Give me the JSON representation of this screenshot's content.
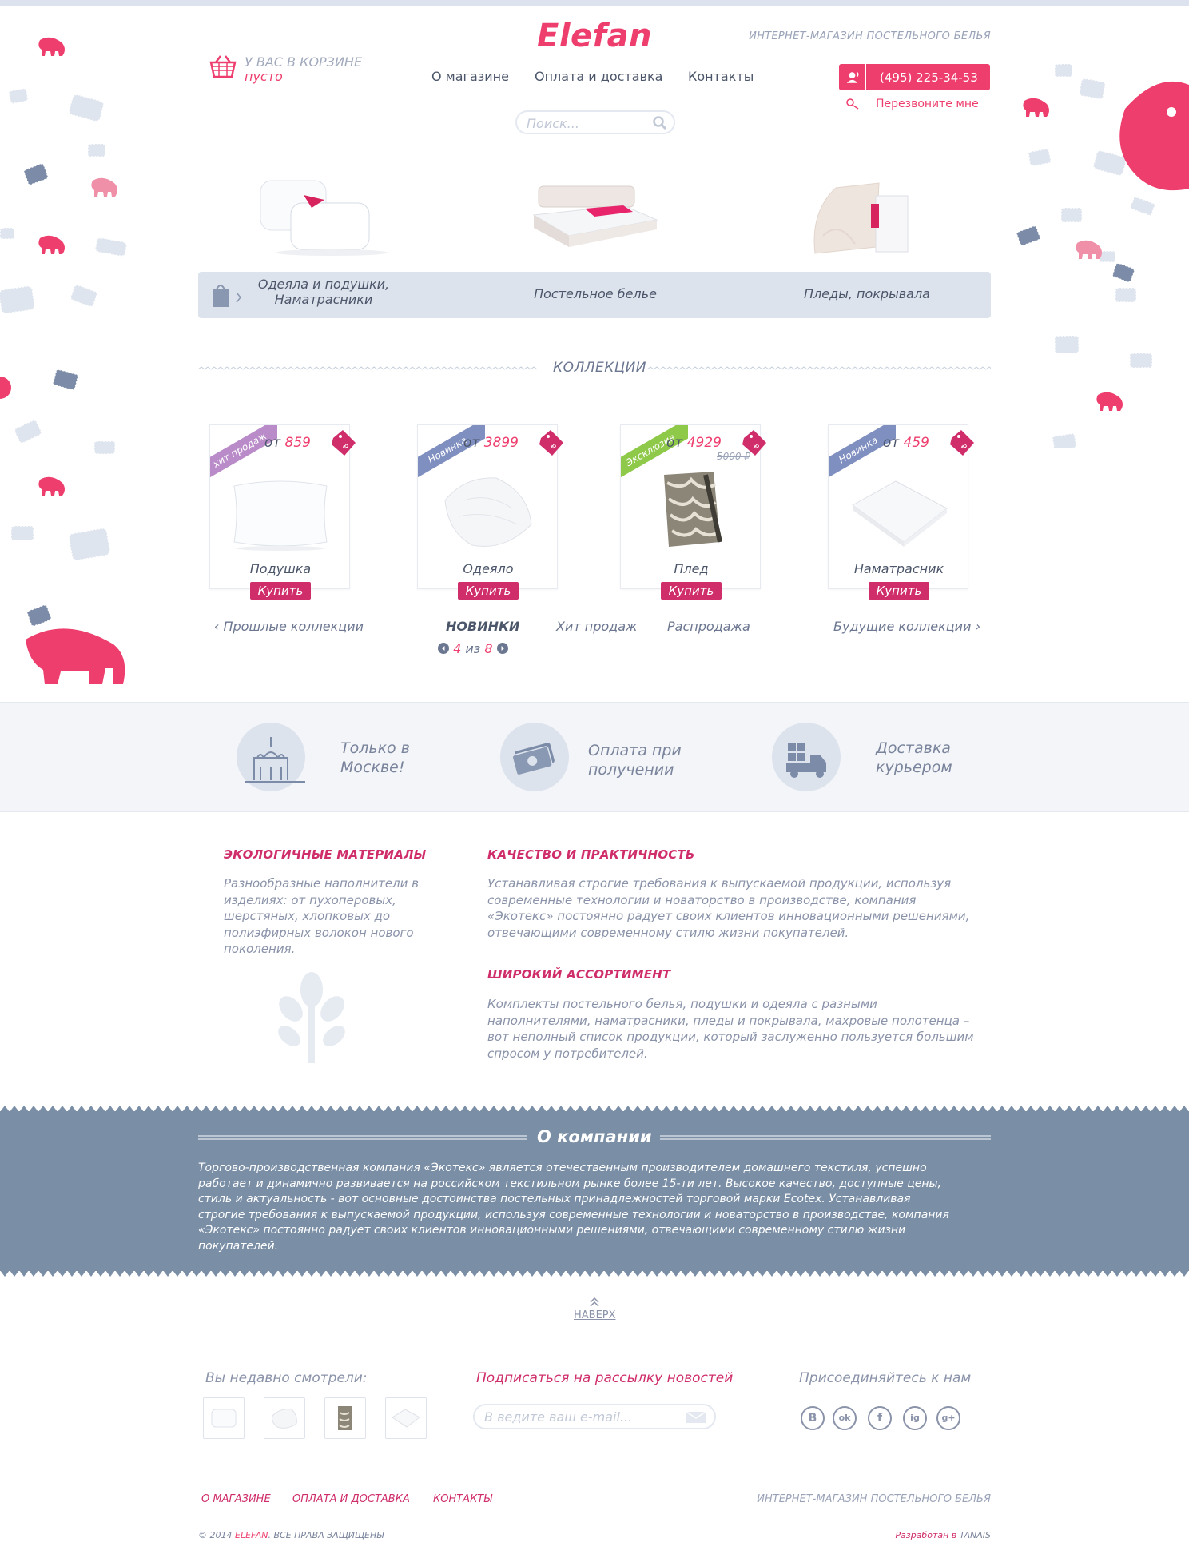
{
  "brand": {
    "logo": "Elefan",
    "tagline": "ИНТЕРНЕТ-МАГАЗИН ПОСТЕЛЬНОГО БЕЛЬЯ"
  },
  "cart": {
    "title": "У ВАС В КОРЗИНЕ",
    "status": "пусто"
  },
  "nav": [
    "О магазине",
    "Оплата и доставка",
    "Контакты"
  ],
  "contact": {
    "phone": "(495) 225-34-53",
    "callback": "Перезвоните мне"
  },
  "search": {
    "placeholder": "Поиск..."
  },
  "categories": [
    {
      "line1": "Одеяла и подушки,",
      "line2": "Наматрасники"
    },
    {
      "label": "Постельное белье"
    },
    {
      "label": "Пледы, покрывала"
    }
  ],
  "collections": {
    "title": "КОЛЛЕКЦИИ",
    "products": [
      {
        "ribbon": "хит продаж",
        "ribbon_color": "#b98bc8",
        "price_prefix": "от",
        "price": "859",
        "name": "Подушка",
        "buy": "Купить"
      },
      {
        "ribbon": "Новинка",
        "ribbon_color": "#7f8fc0",
        "price_prefix": "от",
        "price": "3899",
        "name": "Одеяло",
        "buy": "Купить"
      },
      {
        "ribbon": "Эксклюзив",
        "ribbon_color": "#8fc94a",
        "price_prefix": "от",
        "price": "4929",
        "old_price": "5000 ₽",
        "name": "Плед",
        "buy": "Купить"
      },
      {
        "ribbon": "Новинка",
        "ribbon_color": "#7f8fc0",
        "price_prefix": "от",
        "price": "459",
        "name": "Наматрасник",
        "buy": "Купить"
      }
    ],
    "prev": "Прошлые коллекции",
    "tabs": [
      "НОВИНКИ",
      "Хит продаж",
      "Распродажа"
    ],
    "next": "Будущие коллекции",
    "pager": {
      "current": "4",
      "sep": "из",
      "total": "8"
    }
  },
  "features": [
    {
      "line1": "Только в",
      "line2": "Москве!"
    },
    {
      "line1": "Оплата при",
      "line2": "получении"
    },
    {
      "line1": "Доставка",
      "line2": "курьером"
    }
  ],
  "info": {
    "eco_title": "ЭКОЛОГИЧНЫЕ МАТЕРИАЛЫ",
    "eco_text": [
      "Разнообразные наполнители в",
      "изделиях: от пухоперовых,",
      "шерстяных, хлопковых до",
      "полиэфирных волокон нового",
      "поколения."
    ],
    "quality_title": "КАЧЕСТВО И ПРАКТИЧНОСТЬ",
    "quality_text": [
      "Устанавливая строгие требования к выпускаемой продукции, используя",
      "современные технологии и новаторство в производстве, компания",
      "«Экотекс» постоянно радует своих клиентов инновационными решениями,",
      "отвечающими современному стилю жизни покупателей."
    ],
    "range_title": "ШИРОКИЙ АССОРТИМЕНТ",
    "range_text": [
      "Комплекты постельного белья, подушки и одеяла с разными",
      "наполнителями, наматрасники, пледы и покрывала, махровые полотенца –",
      "вот неполный список продукции, который заслуженно пользуется большим",
      "спросом у потребителей."
    ]
  },
  "about": {
    "title": "О компании",
    "text": [
      "Торгово-производственная компания «Экотекс» является отечественным производителем домашнего текстиля, успешно",
      "работает и динамично развивается на российском текстильном рынке более 15-ти лет. Высокое качество, доступные цены,",
      "стиль и актуальность - вот основные достоинства постельных принадлежностей торговой марки Ecotex. Устанавливая",
      "строгие требования к выпускаемой продукции, используя современные технологии и новаторство в производстве, компания",
      "«Экотекс» постоянно радует своих клиентов инновационными решениями, отвечающими современному стилю жизни",
      "покупателей."
    ]
  },
  "footer": {
    "to_top": "НАВЕРХ",
    "recent": "Вы недавно смотрели:",
    "subscribe": "Подписаться на рассылку новостей",
    "email_placeholder": "В ведите ваш e-mail...",
    "join": "Присоединяйтесь к нам",
    "social": [
      "B",
      "ok",
      "f",
      "ig",
      "g+"
    ],
    "links": [
      "О МАГАЗИНЕ",
      "ОПЛАТА И ДОСТАВКА",
      "КОНТАКТЫ"
    ],
    "tagline": "ИНТЕРНЕТ-МАГАЗИН ПОСТЕЛЬНОГО БЕЛЬЯ",
    "copyright_pre": "© 2014",
    "copyright_brand": "ELEFAN",
    "copyright_post": ". ВСЕ ПРАВА ЗАЩИЩЕНЫ",
    "dev_pre": "Разработан в",
    "dev_name": "TANAIS"
  },
  "colors": {
    "accent": "#ee3e6d",
    "accent_dark": "#cf2e6a",
    "slate": "#7a8ea6",
    "pale": "#dde3ed"
  }
}
